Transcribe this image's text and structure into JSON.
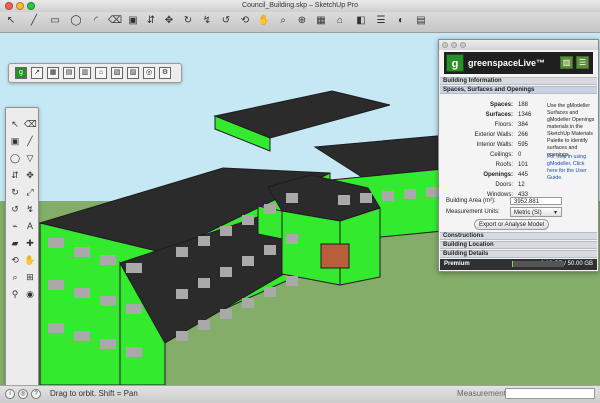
{
  "window": {
    "title": "Council_Building.skp – SketchUp Pro",
    "colors": {
      "close": "#ff5f57",
      "minimize": "#febc2e",
      "zoom": "#28c840"
    }
  },
  "toolbar": {
    "icons": [
      "select-tool-icon",
      "line-tool-icon",
      "rectangle-tool-icon",
      "circle-tool-icon",
      "arc-tool-icon",
      "eraser-tool-icon",
      "paint-bucket-icon",
      "push-pull-icon",
      "move-tool-icon",
      "rotate-tool-icon",
      "follow-me-icon",
      "offset-icon",
      "orbit-icon",
      "pan-icon",
      "zoom-icon",
      "zoom-extents-icon",
      "components-icon",
      "section-plane-icon",
      "styles-icon",
      "layers-icon",
      "shadow-icon",
      "scenes-icon"
    ]
  },
  "floating_toolbar": {
    "icons": [
      "gmodeller-logo-icon",
      "ruler-icon",
      "zone-icon",
      "window-icon",
      "door-icon",
      "roof-icon",
      "wall-icon",
      "floor-icon",
      "analysis-icon",
      "settings-icon",
      "export-icon"
    ]
  },
  "left_tools": {
    "icons": [
      "arrow-icon",
      "eraser-icon",
      "paint-icon",
      "pencil-icon",
      "circle-icon",
      "triangle-icon",
      "push-icon",
      "move-icon",
      "rotate-icon",
      "scale-icon",
      "offset-icon",
      "follow-icon",
      "tape-icon",
      "text-icon",
      "section-icon",
      "axes-icon",
      "orbit-icon",
      "pan-icon",
      "zoom-icon",
      "zoom-window-icon",
      "walk-icon",
      "look-around-icon"
    ]
  },
  "viewport": {
    "colors": {
      "sky": "#c6e8f5",
      "ground": "#84ad69",
      "building_green": "#34ea2f",
      "roof": "#2b2b2b",
      "window": "#a9a9a9"
    }
  },
  "gmodeller": {
    "brand": "greenspaceLive™",
    "sections": {
      "building_information": "Building Information",
      "spaces_surfaces_openings": "Spaces, Surfaces and Openings",
      "constructions": "Constructions",
      "building_location": "Building Location",
      "building_details": "Building Details"
    },
    "stats": {
      "spaces_label": "Spaces:",
      "spaces": "188",
      "surfaces_label": "Surfaces:",
      "surfaces": "1346",
      "floors_label": "Floors:",
      "floors": "384",
      "exterior_walls_label": "Exterior Walls:",
      "exterior_walls": "266",
      "interior_walls_label": "Interior Walls:",
      "interior_walls": "595",
      "ceilings_label": "Ceilings:",
      "ceilings": "0",
      "roofs_label": "Roofs:",
      "roofs": "101",
      "openings_label": "Openings:",
      "openings": "445",
      "doors_label": "Doors:",
      "doors": "12",
      "windows_label": "Windows:",
      "windows": "433"
    },
    "note_text": "Use the gModeller Surfaces and gModeller Openings materials in the SketchUp Materials Palette to identify surfaces and openings.",
    "help_text": "For help in using gModeller, Click here for the User Guide.",
    "building_area_label": "Building Area (m²):",
    "building_area": "3952.881",
    "measurement_units_label": "Measurement Units:",
    "measurement_units": "Metric (SI)",
    "export_button": "Export or Analyse Model",
    "premium_label": "Premium",
    "storage_text": "1.16 GB / 50.00 GB",
    "storage_used_fraction": 0.0232
  },
  "status": {
    "drag_text": "Drag to orbit.  Shift = Pan",
    "measurements_label": "Measurements"
  }
}
